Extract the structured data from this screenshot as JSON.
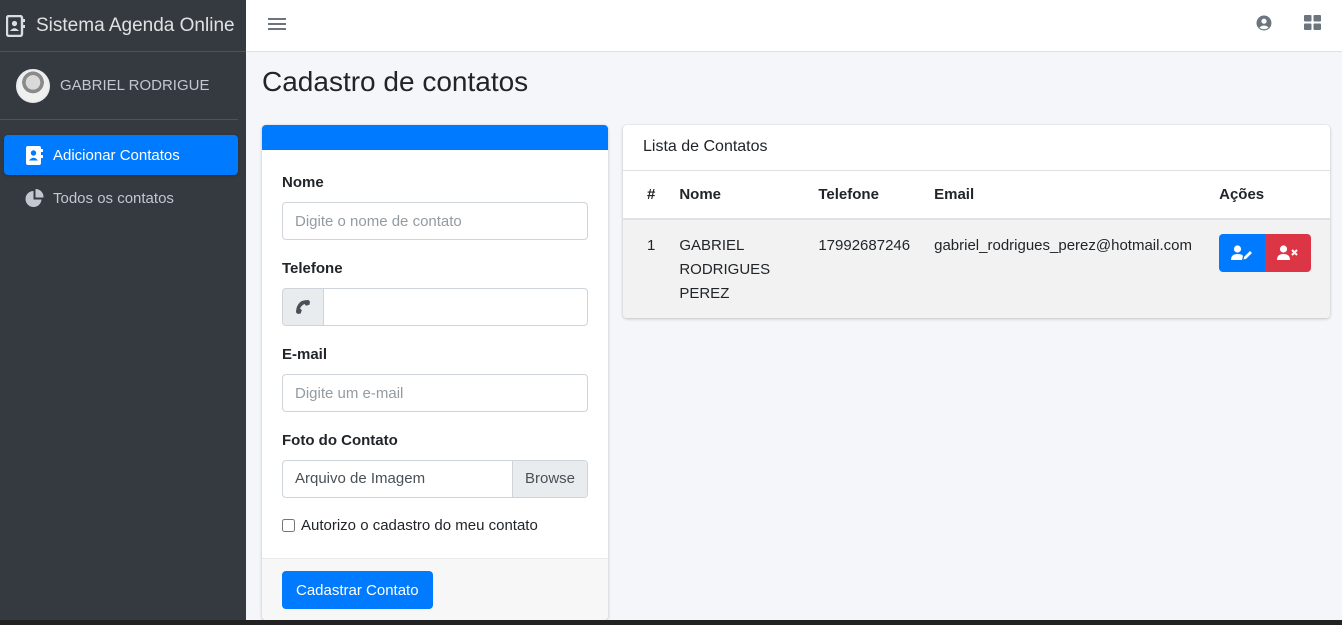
{
  "brand": {
    "title": "Sistema Agenda Online",
    "icon": "address-book-icon"
  },
  "user": {
    "name": "GABRIEL RODRIGUE"
  },
  "sidebar": {
    "items": [
      {
        "label": "Adicionar Contatos",
        "icon": "address-card-icon",
        "active": true
      },
      {
        "label": "Todos os contatos",
        "icon": "pie-chart-icon",
        "active": false
      }
    ]
  },
  "page": {
    "title": "Cadastro de contatos"
  },
  "form": {
    "name_label": "Nome",
    "name_placeholder": "Digite o nome de contato",
    "phone_label": "Telefone",
    "email_label": "E-mail",
    "email_placeholder": "Digite um e-mail",
    "photo_label": "Foto do Contato",
    "file_label": "Arquivo de Imagem",
    "browse_label": "Browse",
    "consent_label": "Autorizo o cadastro do meu contato",
    "submit_label": "Cadastrar Contato"
  },
  "list": {
    "title": "Lista de Contatos",
    "columns": [
      "#",
      "Nome",
      "Telefone",
      "Email",
      "Ações"
    ],
    "rows": [
      {
        "idx": "1",
        "name": "GABRIEL RODRIGUES PEREZ",
        "phone": "17992687246",
        "email": "gabriel_rodrigues_perez@hotmail.com"
      }
    ]
  },
  "colors": {
    "primary": "#007bff",
    "danger": "#dc3545",
    "sidebar": "#343a40"
  }
}
